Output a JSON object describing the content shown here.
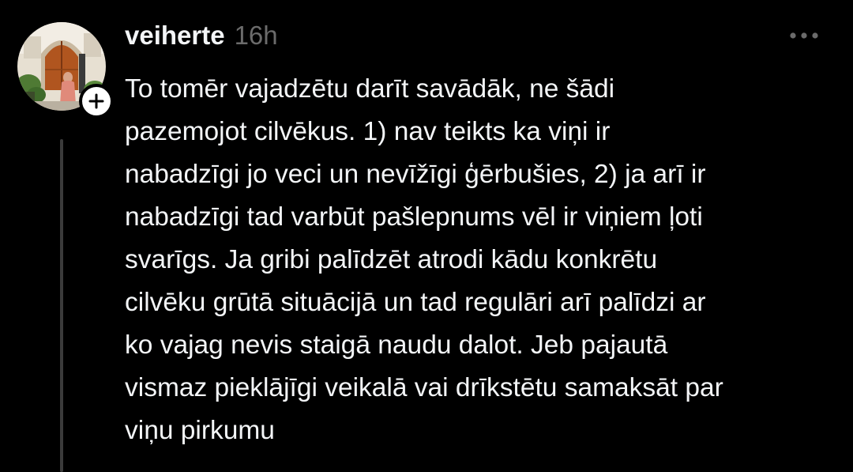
{
  "post": {
    "username": "veiherte",
    "timestamp": "16h",
    "text": "To tomēr vajadzētu darīt savādāk, ne šādi\npazemojot cilvēkus. 1) nav teikts ka viņi ir\nnabadzīgi jo veci un nevīžīgi ģērbušies, 2) ja arī ir\nnabadzīgi tad varbūt pašlepnums vēl ir viņiem ļoti\nsvarīgs. Ja gribi palīdzēt atrodi kādu konkrētu\ncilvēku grūtā situācijā un tad regulāri arī palīdzi ar\nko vajag nevis staigā naudu dalot. Jeb pajautā\nvismaz pieklājīgi veikalā vai drīkstētu samaksāt par\nviņu pirkumu"
  },
  "icons": {
    "follow": "plus-icon",
    "more": "more-horizontal-icon"
  },
  "colors": {
    "background": "#000000",
    "text_primary": "#f3f5f7",
    "text_secondary": "#6b6b6b",
    "thread_line": "#3b3b3b",
    "badge_background": "#ffffff"
  }
}
